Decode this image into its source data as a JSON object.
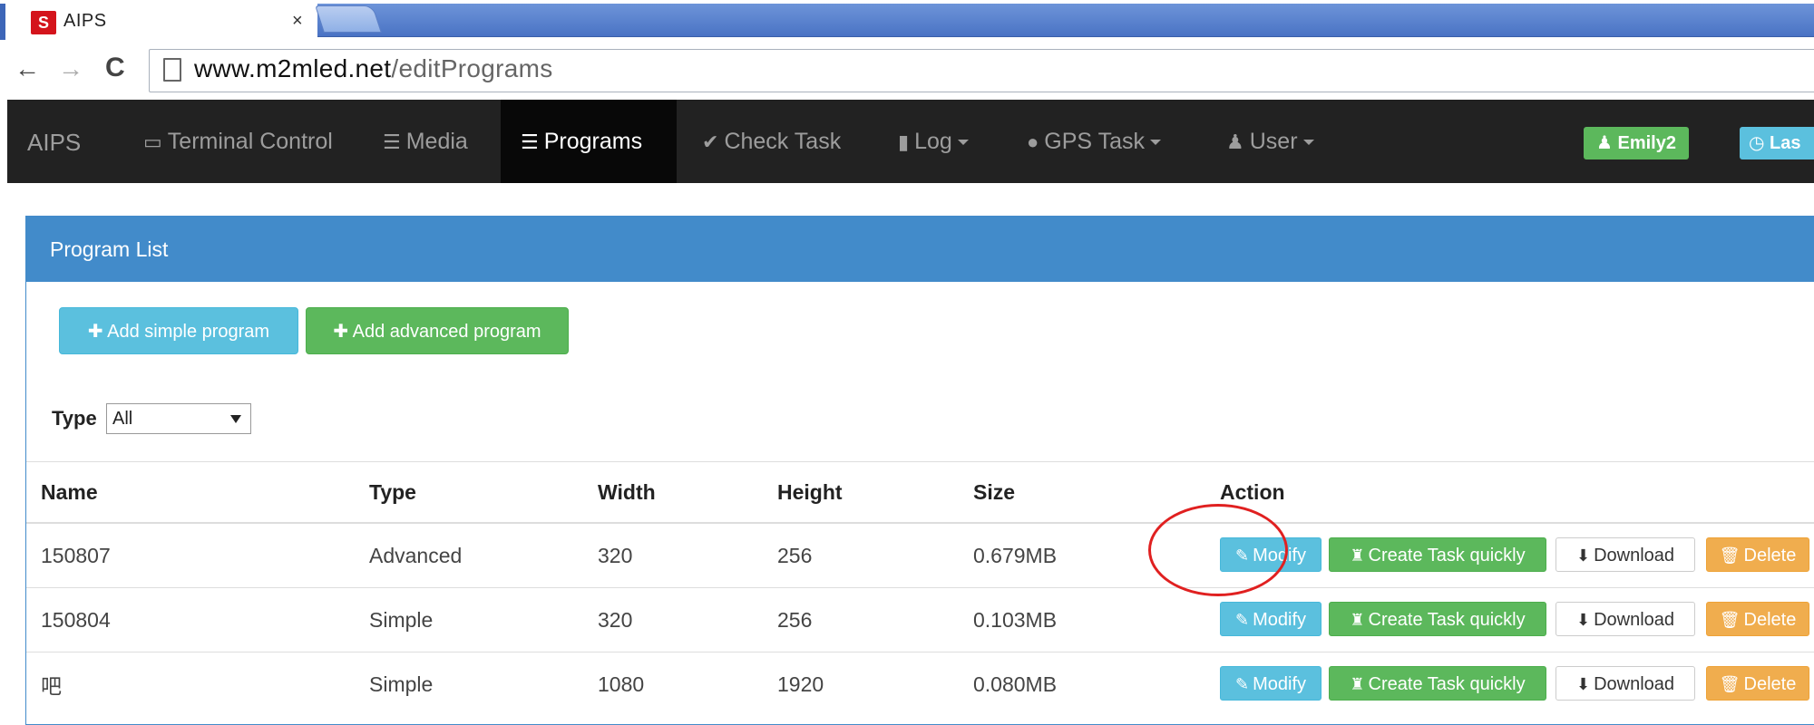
{
  "browser": {
    "tab_title": "AIPS",
    "favicon_letter": "S",
    "close_glyph": "×",
    "url_host": "www.m2mled.net",
    "url_path": "/editPrograms"
  },
  "navbar": {
    "brand": "AIPS",
    "items": [
      {
        "label": "Terminal Control",
        "icon": "monitor-icon"
      },
      {
        "label": "Media",
        "icon": "hdd-icon"
      },
      {
        "label": "Programs",
        "icon": "stack-icon",
        "active": true
      },
      {
        "label": "Check Task",
        "icon": "check-circle-icon"
      },
      {
        "label": "Log",
        "icon": "file-icon",
        "dropdown": true
      },
      {
        "label": "GPS Task",
        "icon": "globe-icon",
        "dropdown": true
      },
      {
        "label": "User",
        "icon": "user-icon",
        "dropdown": true
      }
    ],
    "user_badge": "Emily2",
    "last_badge": "Las"
  },
  "panel": {
    "title": "Program List",
    "add_simple": "Add simple program",
    "add_advanced": "Add advanced program",
    "filter_label": "Type",
    "filter_value": "All"
  },
  "table": {
    "headers": [
      "Name",
      "Type",
      "Width",
      "Height",
      "Size",
      "Action"
    ],
    "rows": [
      {
        "name": "150807",
        "type": "Advanced",
        "width": "320",
        "height": "256",
        "size": "0.679MB"
      },
      {
        "name": "150804",
        "type": "Simple",
        "width": "320",
        "height": "256",
        "size": "0.103MB"
      },
      {
        "name": "吧",
        "type": "Simple",
        "width": "1080",
        "height": "1920",
        "size": "0.080MB"
      }
    ],
    "actions": {
      "modify": "Modify",
      "create_task": "Create Task quickly",
      "download": "Download",
      "delete": "Delete"
    }
  },
  "colors": {
    "primary": "#428bca",
    "info": "#5bc0de",
    "success": "#5cb85c",
    "warning": "#f0ad4e",
    "navbar": "#222222",
    "annotation": "#e02020"
  }
}
